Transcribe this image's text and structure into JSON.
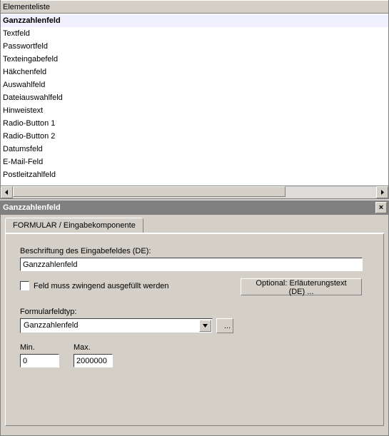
{
  "list": {
    "header": "Elementeliste",
    "items": [
      "Ganzzahlenfeld",
      "Textfeld",
      "Passwortfeld",
      "Texteingabefeld",
      "Häkchenfeld",
      "Auswahlfeld",
      "Dateiauswahlfeld",
      "Hinweistext",
      "Radio-Button 1",
      "Radio-Button 2",
      "Datumsfeld",
      "E-Mail-Feld",
      "Postleitzahlfeld"
    ],
    "selected_index": 0
  },
  "panel": {
    "title": "Ganzzahlenfeld",
    "tab_label": "FORMULAR / Eingabekomponente",
    "field_label": "Beschriftung des Eingabefeldes (DE):",
    "field_value": "Ganzzahlenfeld",
    "required_label": "Feld muss zwingend ausgefüllt werden",
    "required_checked": false,
    "optional_btn": "Optional: Erläuterungstext (DE) ...",
    "type_label": "Formularfeldtyp:",
    "type_value": "Ganzzahlenfeld",
    "dots": "...",
    "min_label": "Min.",
    "min_value": "0",
    "max_label": "Max.",
    "max_value": "2000000"
  }
}
